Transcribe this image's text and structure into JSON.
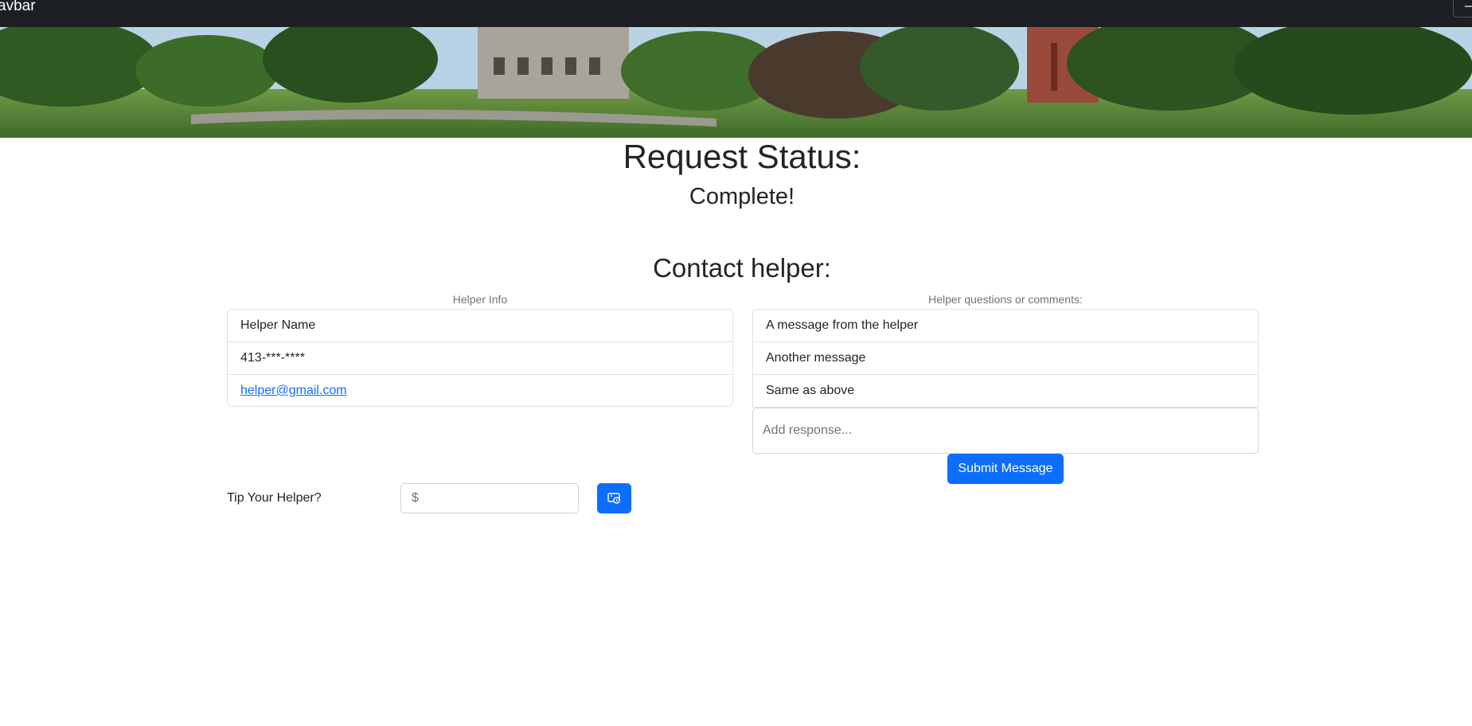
{
  "navbar": {
    "brand": "avbar"
  },
  "header": {
    "status_title": "Request Status:",
    "status_value": "Complete!",
    "contact_title": "Contact helper:"
  },
  "helper_info": {
    "caption": "Helper Info",
    "name": "Helper Name",
    "phone": "413-***-****",
    "email": "helper@gmail.com"
  },
  "messages": {
    "caption": "Helper questions or comments:",
    "items": [
      "A message from the helper",
      "Another message",
      "Same as above"
    ],
    "response_placeholder": "Add response...",
    "submit_label": "Submit Message"
  },
  "tip": {
    "label": "Tip Your Helper?",
    "currency_prefix": "$",
    "amount": ""
  },
  "colors": {
    "navbar_bg": "#1c1f23",
    "primary": "#0d6efd",
    "text": "#212529",
    "muted": "#6c757d"
  },
  "icons": {
    "tip_button": "cash-coin-icon",
    "menu": "hamburger-icon"
  }
}
